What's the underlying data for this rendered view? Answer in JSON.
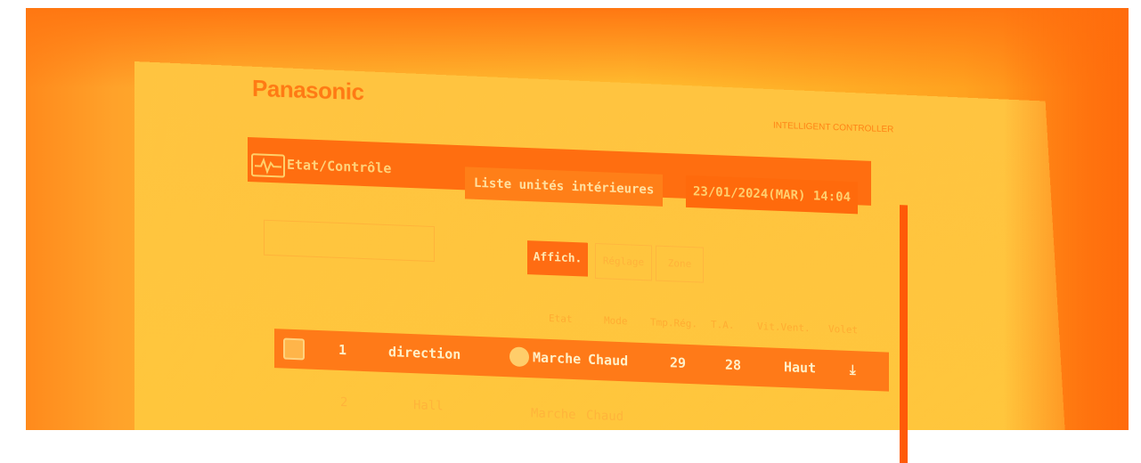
{
  "brand": "Panasonic",
  "model_label": "INTELLIGENT CONTROLLER",
  "header": {
    "title": "Etat/Contrôle",
    "list_button": "Liste unités intérieures",
    "datetime": "23/01/2024(MAR) 14:04"
  },
  "toolbar": {
    "affich": "Affich.",
    "button2": "Réglage",
    "button3": "Zone"
  },
  "table": {
    "columns": [
      "Etat",
      "Mode",
      "Tmp.Rég.",
      "T.A.",
      "Vit.Vent.",
      "Volet"
    ],
    "rows": [
      {
        "no": "1",
        "name": "direction",
        "etat": "Marche",
        "mode": "Chaud",
        "set": "29",
        "room": "28",
        "fan": "Haut"
      },
      {
        "no": "2",
        "name": "Hall",
        "etat": "Marche",
        "mode": "Chaud",
        "set": "",
        "room": "",
        "fan": ""
      }
    ]
  },
  "colors": {
    "tint": "#ffb52e",
    "header_bg": "#ff6e10",
    "highlight_row": "#ff7a18"
  }
}
